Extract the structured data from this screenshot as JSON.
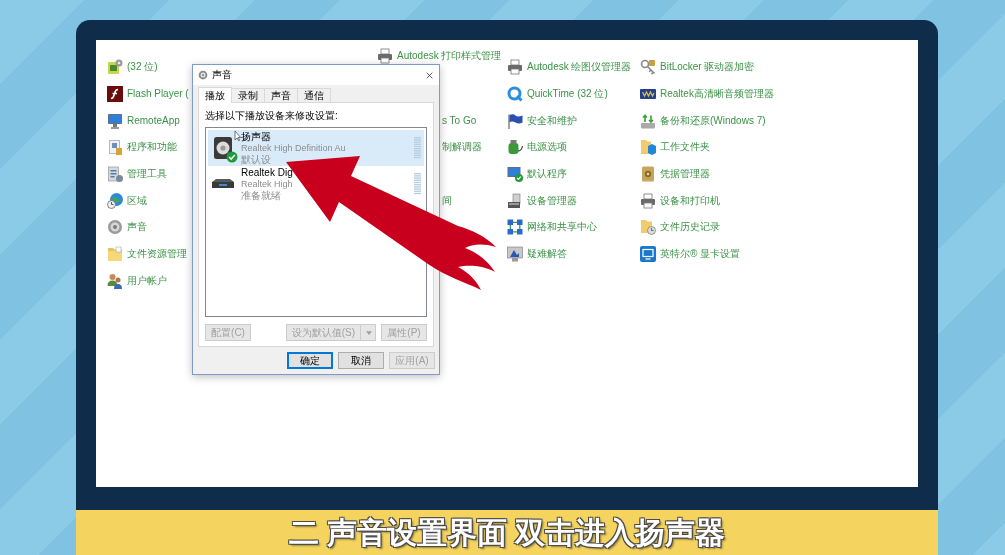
{
  "control_panel": {
    "columns": [
      {
        "items": [
          {
            "label": "(32 位)"
          },
          {
            "label": "Flash Player ("
          },
          {
            "label": "RemoteApp"
          },
          {
            "label": "程序和功能"
          },
          {
            "label": "管理工具"
          },
          {
            "label": "区域"
          },
          {
            "label": "声音"
          },
          {
            "label": "文件资源管理"
          },
          {
            "label": "用户帐户"
          }
        ]
      },
      {
        "items": [
          {
            "label": "Autodesk 打印样式管理"
          },
          {
            "label": "s To Go"
          },
          {
            "label": "制解调器"
          },
          {
            "label": "间"
          }
        ]
      },
      {
        "items": [
          {
            "label": "Autodesk 绘图仪管理器"
          },
          {
            "label": "QuickTime (32 位)"
          },
          {
            "label": "安全和维护"
          },
          {
            "label": "电源选项"
          },
          {
            "label": "默认程序"
          },
          {
            "label": "设备管理器"
          },
          {
            "label": "网络和共享中心"
          },
          {
            "label": "疑难解答"
          }
        ]
      },
      {
        "items": [
          {
            "label": "BitLocker 驱动器加密"
          },
          {
            "label": "Realtek高清晰音频管理器"
          },
          {
            "label": "备份和还原(Windows 7)"
          },
          {
            "label": "工作文件夹"
          },
          {
            "label": "凭据管理器"
          },
          {
            "label": "设备和打印机"
          },
          {
            "label": "文件历史记录"
          },
          {
            "label": "英特尔® 显卡设置"
          }
        ]
      }
    ]
  },
  "dialog": {
    "title": "声音",
    "tabs": [
      {
        "label": "播放",
        "selected": true
      },
      {
        "label": "录制",
        "selected": false
      },
      {
        "label": "声音",
        "selected": false
      },
      {
        "label": "通信",
        "selected": false
      }
    ],
    "instruction": "选择以下播放设备来修改设置:",
    "devices": [
      {
        "name": "扬声器",
        "driver": "Realtek High Definition Au",
        "status": "默认设",
        "selected": true,
        "default": true
      },
      {
        "name": "Realtek Dig",
        "driver": "Realtek High",
        "status": "准备就绪",
        "selected": false,
        "default": false
      }
    ],
    "list_buttons": [
      {
        "label": "配置(C)",
        "disabled": true,
        "kind": "plain"
      },
      {
        "label": "设为默认值(S)",
        "disabled": true,
        "kind": "split"
      },
      {
        "label": "属性(P)",
        "disabled": true,
        "kind": "plain"
      }
    ],
    "footer_buttons": [
      {
        "label": "确定",
        "disabled": false,
        "default": true
      },
      {
        "label": "取消",
        "disabled": false,
        "default": false
      },
      {
        "label": "应用(A)",
        "disabled": true,
        "default": false
      }
    ]
  },
  "caption": "二 声音设置界面 双击进入扬声器"
}
